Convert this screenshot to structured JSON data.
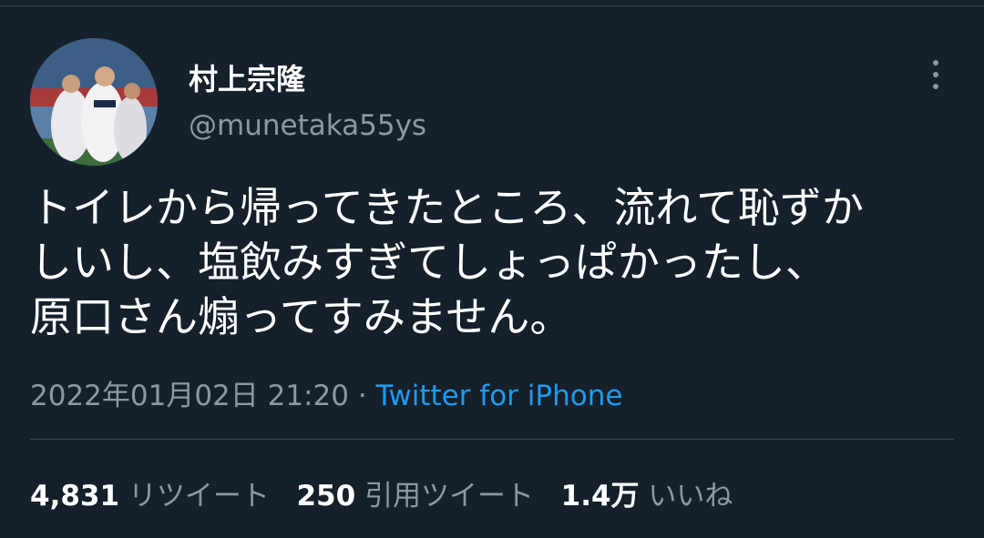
{
  "user": {
    "display_name": "村上宗隆",
    "handle": "@munetaka55ys"
  },
  "tweet": {
    "text_lines": [
      "トイレから帰ってきたところ、流れて恥ずか",
      "しいし、塩飲みすぎてしょっぱかったし、",
      "原口さん煽ってすみません。"
    ],
    "timestamp": "2022年01月02日 21:20",
    "separator": " · ",
    "source": "Twitter for iPhone"
  },
  "stats": {
    "retweets_count": "4,831",
    "retweets_label": "リツイート",
    "quotes_count": "250",
    "quotes_label": "引用ツイート",
    "likes_count": "1.4万",
    "likes_label": "いいね"
  },
  "icons": {
    "more": "more-vertical-icon"
  },
  "colors": {
    "background": "#15202b",
    "text_primary": "#ffffff",
    "text_secondary": "#8b98a5",
    "link": "#1d9bf0",
    "divider": "#38444d"
  }
}
